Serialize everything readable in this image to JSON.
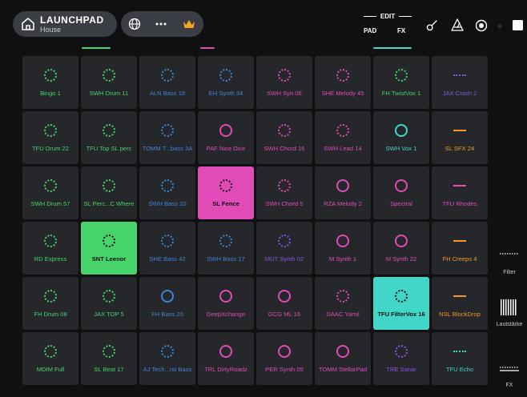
{
  "header": {
    "project_title": "LAUNCHPAD",
    "project_subtitle": "House",
    "edit_label": "EDIT",
    "pad_label": "PAD",
    "fx_label": "FX"
  },
  "colors": {
    "green": "#45d36a",
    "blue": "#3f84d8",
    "pink": "#e04bb8",
    "purple": "#8a52e8",
    "orange": "#f4962a",
    "cyan": "#41d6c8",
    "crown": "#f4a623"
  },
  "grid": {
    "columns": [
      {
        "color": "green",
        "pads": [
          {
            "label": "Bingo 1",
            "icon": "dashed"
          },
          {
            "label": "TFU Drum 22",
            "icon": "dashed"
          },
          {
            "label": "SWH Drum 57",
            "icon": "dashed"
          },
          {
            "label": "RD Express",
            "icon": "dashed"
          },
          {
            "label": "FH Drum 08",
            "icon": "dashed"
          },
          {
            "label": "MDIM Full",
            "icon": "dashed"
          }
        ]
      },
      {
        "color": "green",
        "pads": [
          {
            "label": "SWH Drum 11",
            "icon": "dashed"
          },
          {
            "label": "TFU Top SL perc",
            "icon": "dashed"
          },
          {
            "label": "SL Perc...C Where",
            "icon": "dashed"
          },
          {
            "label": "SNT Leenor",
            "icon": "dashed",
            "active": true
          },
          {
            "label": "JAX TOP 5",
            "icon": "dashed"
          },
          {
            "label": "SL Beat 17",
            "icon": "dashed"
          }
        ]
      },
      {
        "color": "blue",
        "pads": [
          {
            "label": "ALN Bass 18",
            "icon": "dashed"
          },
          {
            "label": "TOMM T...bass 3A",
            "icon": "dashed"
          },
          {
            "label": "SWH Bass 20",
            "icon": "dashed"
          },
          {
            "label": "SHE Bass 42",
            "icon": "dashed"
          },
          {
            "label": "FH Bass 20",
            "icon": "solid"
          },
          {
            "label": "AJ Tech...no Bass",
            "icon": "dashed"
          }
        ]
      },
      {
        "color": "blue",
        "pads": [
          {
            "label": "EH Synth 34",
            "icon": "dashed",
            "color": "blue"
          },
          {
            "label": "PAF Nice Dice",
            "icon": "solid",
            "color": "pink"
          },
          {
            "label": "SL Fence",
            "icon": "dashed",
            "color": "pink",
            "active": true
          },
          {
            "label": "SWH Bass 17",
            "icon": "dashed",
            "color": "blue"
          },
          {
            "label": "DeepXchange",
            "icon": "solid",
            "color": "pink"
          },
          {
            "label": "TRL DirtyRoadz",
            "icon": "solid",
            "color": "pink"
          }
        ]
      },
      {
        "color": "pink",
        "pads": [
          {
            "label": "SWH Syn 06",
            "icon": "dashed",
            "color": "pink"
          },
          {
            "label": "SWH Chord 16",
            "icon": "dashed",
            "color": "pink"
          },
          {
            "label": "SWH Chord 5",
            "icon": "dashed",
            "color": "pink"
          },
          {
            "label": "MUT Synth 02",
            "icon": "dashed",
            "color": "purple"
          },
          {
            "label": "GCG ML 16",
            "icon": "solid",
            "color": "pink"
          },
          {
            "label": "PER Synth 05",
            "icon": "solid",
            "color": "pink"
          }
        ]
      },
      {
        "color": "pink",
        "pads": [
          {
            "label": "SHE Melody 45",
            "icon": "dashed"
          },
          {
            "label": "SWH Lead 14",
            "icon": "dashed"
          },
          {
            "label": "RZA Melody 2",
            "icon": "solid"
          },
          {
            "label": "M Synth 1",
            "icon": "solid"
          },
          {
            "label": "DAAC Yamil",
            "icon": "dashed"
          },
          {
            "label": "TOMM StellarPad",
            "icon": "solid"
          }
        ]
      },
      {
        "color": "pink",
        "pads": [
          {
            "label": "FH TwistVox 1",
            "icon": "dashed",
            "color": "green"
          },
          {
            "label": "SWH Vox 1",
            "icon": "solid",
            "color": "cyan"
          },
          {
            "label": "Spectral",
            "icon": "solid",
            "color": "pink"
          },
          {
            "label": "M Synth 22",
            "icon": "solid",
            "color": "pink"
          },
          {
            "label": "TFU FilterVox 16",
            "icon": "dashed",
            "color": "cyan",
            "active": true
          },
          {
            "label": "TRE Sonar",
            "icon": "dashed",
            "color": "purple"
          }
        ]
      },
      {
        "color": "orange",
        "pads": [
          {
            "label": "JAX Crash 2",
            "icon": "dash-dotted",
            "color": "purple"
          },
          {
            "label": "SL SFX 24",
            "icon": "dash-solid",
            "color": "orange"
          },
          {
            "label": "TFU Rhodes",
            "icon": "dash-solid",
            "color": "pink"
          },
          {
            "label": "FH Creeps 4",
            "icon": "dash-solid",
            "color": "orange"
          },
          {
            "label": "NSL BlockDrop",
            "icon": "dash-solid",
            "color": "orange"
          },
          {
            "label": "TFU Echo",
            "icon": "dash-dotted",
            "color": "cyan"
          }
        ]
      }
    ]
  },
  "side": {
    "filter_label": "Filter",
    "volume_label": "Lautstärke",
    "fx_label": "FX"
  }
}
